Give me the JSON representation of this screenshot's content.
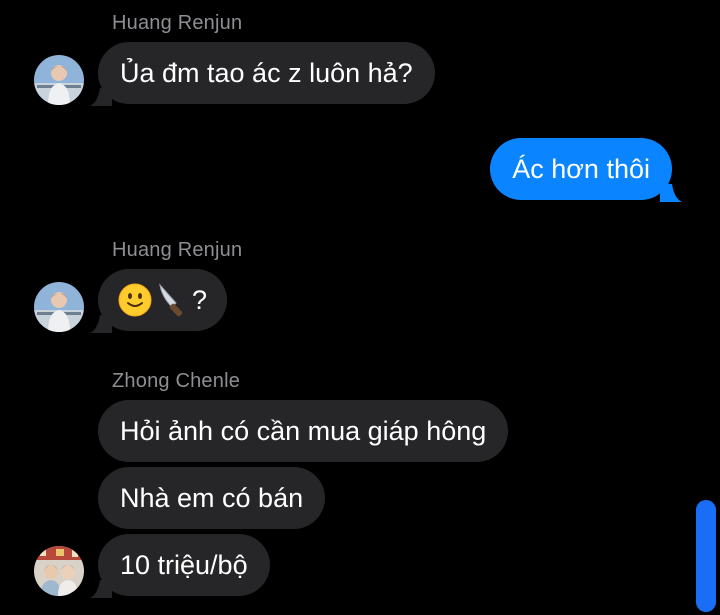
{
  "colors": {
    "background": "#000000",
    "incoming_bubble": "#262629",
    "outgoing_bubble": "#0a84ff",
    "sender_name": "#8e8e93",
    "scrollbar": "#1a6ef5"
  },
  "messages": [
    {
      "sender": "Huang Renjun",
      "direction": "incoming",
      "avatar": "renjun-avatar",
      "text": "Ủa đm tao ác z luôn hả?"
    },
    {
      "direction": "outgoing",
      "text": "Ác hơn thôi"
    },
    {
      "sender": "Huang Renjun",
      "direction": "incoming",
      "avatar": "renjun-avatar",
      "emoji": [
        "slightly-smiling-face-emoji",
        "knife-emoji"
      ],
      "text": "?"
    },
    {
      "sender": "Zhong Chenle",
      "direction": "incoming",
      "avatar": "chenle-avatar",
      "text_group": [
        "Hỏi ảnh có cần mua giáp hông",
        "Nhà em có bán",
        "10 triệu/bộ"
      ]
    }
  ]
}
